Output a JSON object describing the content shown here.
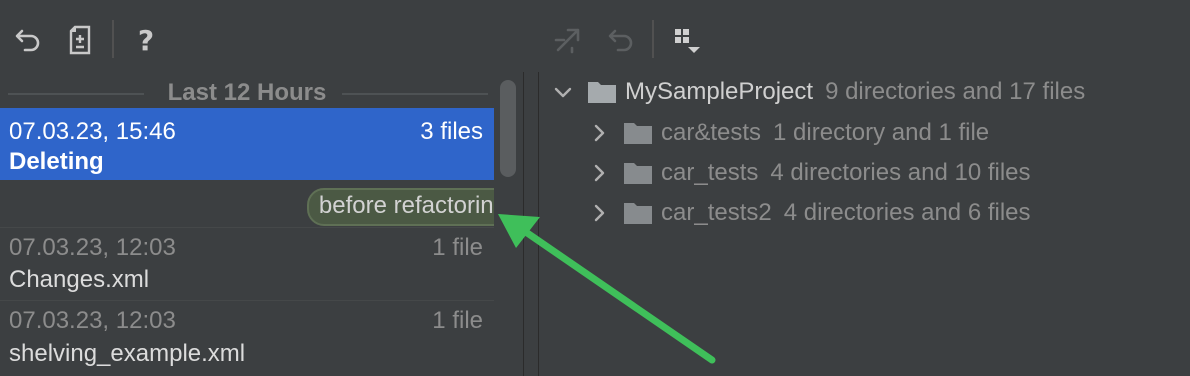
{
  "toolbar": {
    "left_buttons": [
      {
        "icon": "undo-icon"
      },
      {
        "icon": "show-diff-icon"
      },
      {
        "icon": "help-icon",
        "glyph": "?"
      }
    ],
    "right_buttons": [
      {
        "icon": "merge-icon",
        "enabled": false
      },
      {
        "icon": "revert-icon",
        "enabled": false
      },
      {
        "icon": "group-by-icon",
        "enabled": true
      }
    ]
  },
  "history": {
    "group_label": "Last 12 Hours",
    "revisions": [
      {
        "date": "07.03.23, 15:46",
        "count": "3 files",
        "name": "Deleting",
        "selected": true
      },
      {
        "date": "07.03.23, 12:03",
        "count": "1 file",
        "name": "Changes.xml",
        "selected": false
      },
      {
        "date": "07.03.23, 12:03",
        "count": "1 file",
        "name": "shelving_example.xml",
        "selected": false
      }
    ],
    "label_badge": "before refactoring"
  },
  "tree": {
    "root": {
      "name": "MySampleProject",
      "info": "9 directories and 17 files"
    },
    "children": [
      {
        "name": "car&tests",
        "info": "1 directory and 1 file"
      },
      {
        "name": "car_tests",
        "info": "4 directories and 10 files"
      },
      {
        "name": "car_tests2",
        "info": "4 directories and 6 files"
      }
    ]
  },
  "colors": {
    "background": "#3c3f41",
    "selection": "#2f65ca",
    "badge": "#4b5944",
    "annotation_arrow": "#3fbf5a"
  }
}
